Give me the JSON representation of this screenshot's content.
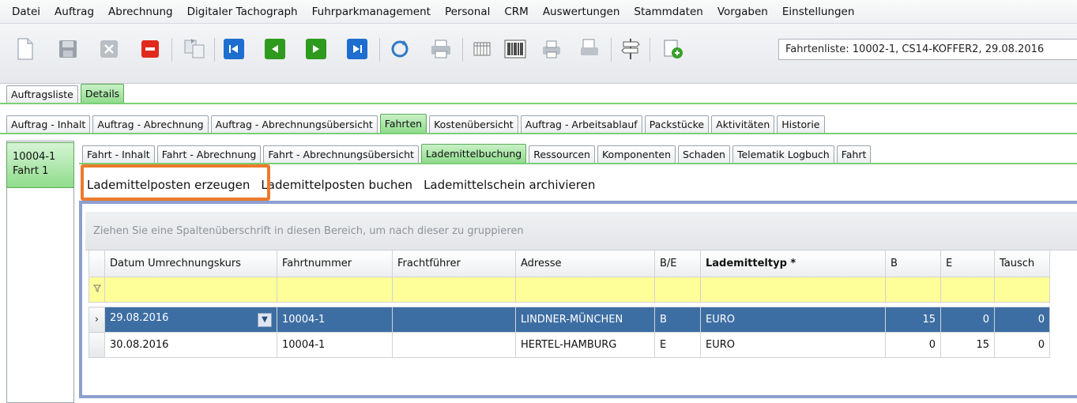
{
  "menu": [
    "Datei",
    "Auftrag",
    "Abrechnung",
    "Digitaler Tachograph",
    "Fuhrparkmanagement",
    "Personal",
    "CRM",
    "Auswertungen",
    "Stammdaten",
    "Vorgaben",
    "Einstellungen"
  ],
  "toolbar": {
    "context": "Fahrtenliste: 10002-1, CS14-KOFFER2, 29.08.2016",
    "icons": [
      "new-doc",
      "save",
      "cancel",
      "delete",
      "copy",
      "first",
      "previous",
      "next",
      "last",
      "refresh",
      "print",
      "columns",
      "barcode",
      "print-stack",
      "print-doc",
      "signpost",
      "export"
    ]
  },
  "tabs_level1": [
    {
      "label": "Auftragsliste",
      "active": false
    },
    {
      "label": "Details",
      "active": true
    }
  ],
  "tabs_level2": [
    {
      "label": "Auftrag - Inhalt",
      "active": false
    },
    {
      "label": "Auftrag - Abrechnung",
      "active": false
    },
    {
      "label": "Auftrag - Abrechnungsübersicht",
      "active": false
    },
    {
      "label": "Fahrten",
      "active": true
    },
    {
      "label": "Kostenübersicht",
      "active": false
    },
    {
      "label": "Auftrag - Arbeitsablauf",
      "active": false
    },
    {
      "label": "Packstücke",
      "active": false
    },
    {
      "label": "Aktivitäten",
      "active": false
    },
    {
      "label": "Historie",
      "active": false
    }
  ],
  "tabs_level3": [
    {
      "label": "Fahrt - Inhalt",
      "active": false
    },
    {
      "label": "Fahrt - Abrechnung",
      "active": false
    },
    {
      "label": "Fahrt - Abrechnungsübersicht",
      "active": false
    },
    {
      "label": "Lademittelbuchung",
      "active": true
    },
    {
      "label": "Ressourcen",
      "active": false
    },
    {
      "label": "Komponenten",
      "active": false
    },
    {
      "label": "Schaden",
      "active": false
    },
    {
      "label": "Telematik Logbuch",
      "active": false
    },
    {
      "label": "Fahrt",
      "active": false
    }
  ],
  "trip": {
    "line1": "10004-1",
    "line2": "Fahrt 1"
  },
  "actions": [
    "Lademittelposten erzeugen",
    "Lademittelposten buchen",
    "Lademittelschein archivieren"
  ],
  "grid": {
    "group_hint": "Ziehen Sie eine Spaltenüberschrift in diesen Bereich, um nach dieser zu gruppieren",
    "columns": [
      "Datum Umrechnungskurs",
      "Fahrtnummer",
      "Frachtführer",
      "Adresse",
      "B/E",
      "Lademitteltyp *",
      "B",
      "E",
      "Tausch"
    ],
    "rows": [
      {
        "datum": "29.08.2016",
        "fahrtnummer": "10004-1",
        "frachtfuehrer": "",
        "adresse": "LINDNER-MÜNCHEN",
        "be": "B",
        "typ": "EURO",
        "b": "15",
        "e": "0",
        "tausch": "0",
        "selected": true
      },
      {
        "datum": "30.08.2016",
        "fahrtnummer": "10004-1",
        "frachtfuehrer": "",
        "adresse": "HERTEL-HAMBURG",
        "be": "E",
        "typ": "EURO",
        "b": "0",
        "e": "15",
        "tausch": "0",
        "selected": false
      }
    ]
  },
  "colors": {
    "active_tab": "#8fdc8c",
    "selected_row": "#3d6ea3",
    "filter_row": "#ffff99",
    "highlight": "#ec7a2c"
  }
}
